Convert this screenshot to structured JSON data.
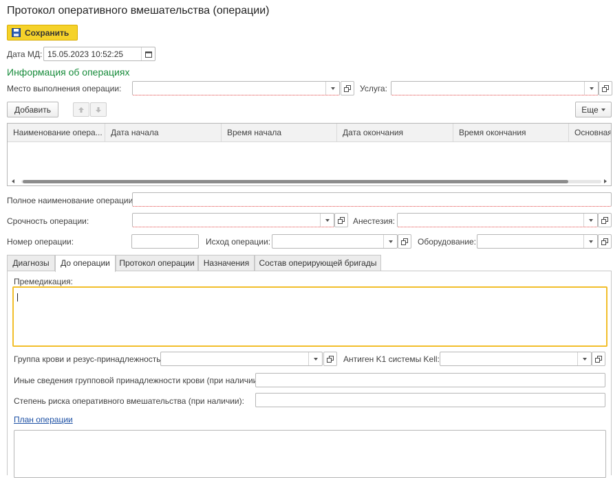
{
  "page_title": "Протокол оперативного вмешательства (операции)",
  "toolbar": {
    "save_label": "Сохранить"
  },
  "date": {
    "label": "Дата МД:",
    "value": "15.05.2023 10:52:25"
  },
  "section_title": "Информация об операциях",
  "place": {
    "label": "Место выполнения операции:",
    "value": ""
  },
  "service": {
    "label": "Услуга:",
    "value": ""
  },
  "table_toolbar": {
    "add_label": "Добавить",
    "more_label": "Еще"
  },
  "table": {
    "columns": [
      "Наименование опера...",
      "Дата начала",
      "Время начала",
      "Дата окончания",
      "Время окончания",
      "Основная"
    ],
    "rows": []
  },
  "full_name": {
    "label": "Полное наименование операции:",
    "value": ""
  },
  "urgency": {
    "label": "Срочность операции:",
    "value": ""
  },
  "anesthesia": {
    "label": "Анестезия:",
    "value": ""
  },
  "op_number": {
    "label": "Номер операции:",
    "value": ""
  },
  "outcome": {
    "label": "Исход операции:",
    "value": ""
  },
  "equipment": {
    "label": "Оборудование:",
    "value": ""
  },
  "tabs": [
    {
      "label": "Диагнозы",
      "active": false
    },
    {
      "label": "До операции",
      "active": true
    },
    {
      "label": "Протокол операции",
      "active": false
    },
    {
      "label": "Назначения",
      "active": false
    },
    {
      "label": "Состав оперирующей бригады",
      "active": false
    }
  ],
  "premedication": {
    "label": "Премедикация:",
    "value": ""
  },
  "blood_group": {
    "label": "Группа крови и резус-принадлежность:",
    "value": ""
  },
  "kell": {
    "label": "Антиген K1 системы Kell:",
    "value": ""
  },
  "other_blood": {
    "label": "Иные сведения групповой принадлежности крови (при наличии):",
    "value": ""
  },
  "risk": {
    "label": "Степень риска оперативного вмешательства (при наличии):",
    "value": ""
  },
  "plan_link": "План операции",
  "colors": {
    "accent": "#f5d22a",
    "section": "#168b3a",
    "focus": "#f2be2a",
    "link": "#1a4ea3",
    "required": "#e04040"
  }
}
